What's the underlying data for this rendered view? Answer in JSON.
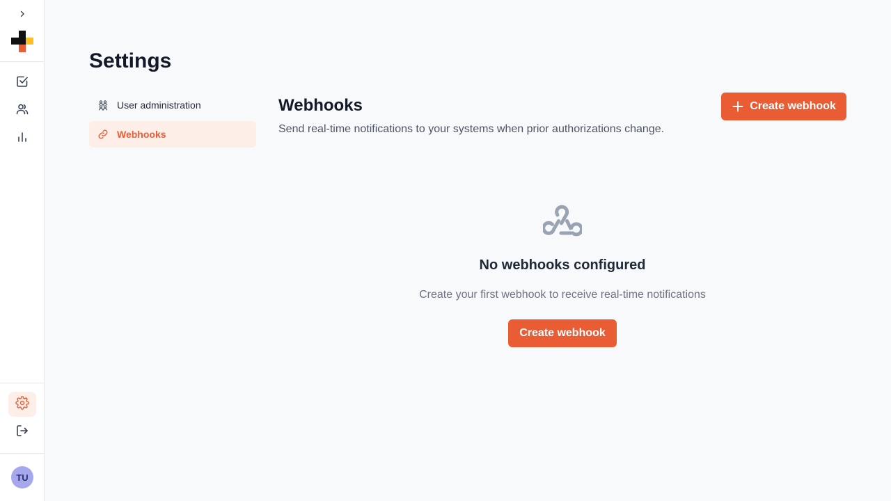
{
  "sidebar": {
    "expand_icon": "chevron-right-icon",
    "logo": {
      "colors": [
        "#111111",
        "#fbbf24",
        "#ea5c34"
      ]
    },
    "nav_icons": [
      "checkbox-icon",
      "users-icon",
      "bar-chart-icon"
    ],
    "bottom_icons": [
      "gear-icon",
      "logout-icon"
    ],
    "active_icon": "gear-icon",
    "avatar_initials": "TU"
  },
  "page": {
    "title": "Settings"
  },
  "settings_nav": {
    "items": [
      {
        "label": "User administration",
        "icon": "user-group-icon",
        "active": false
      },
      {
        "label": "Webhooks",
        "icon": "link-icon",
        "active": true
      }
    ]
  },
  "webhooks": {
    "title": "Webhooks",
    "description": "Send real-time notifications to your systems when prior authorizations change.",
    "create_button_label": "Create webhook",
    "empty_state": {
      "icon": "webhook-icon",
      "title": "No webhooks configured",
      "description": "Create your first webhook to receive real-time notifications",
      "button_label": "Create webhook"
    }
  },
  "colors": {
    "accent": "#ea5c34",
    "accent_soft": "#fdeee8",
    "background": "#f8f9fb",
    "avatar": "#a5a8ec"
  }
}
